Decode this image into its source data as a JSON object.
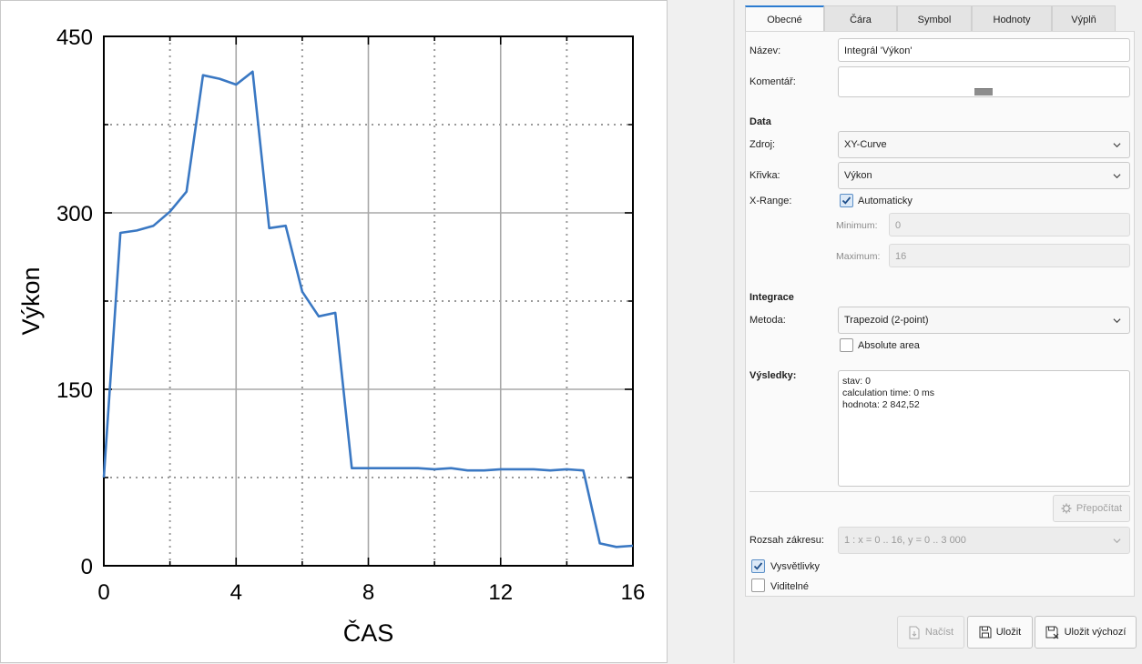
{
  "chart_data": {
    "type": "line",
    "xlabel": "ČAS",
    "ylabel": "Výkon",
    "xlim": [
      0,
      16
    ],
    "ylim": [
      0,
      450
    ],
    "x_ticks": [
      0,
      4,
      8,
      12,
      16
    ],
    "y_ticks": [
      0,
      150,
      300,
      450
    ],
    "grid": true,
    "series": [
      {
        "color": "#3a78c3",
        "x": [
          0,
          0.5,
          1,
          1.5,
          2,
          2.5,
          3,
          3.5,
          4,
          4.5,
          5,
          5.5,
          6,
          6.5,
          7,
          7.5,
          8,
          8.5,
          9,
          9.5,
          10,
          10.5,
          11,
          11.5,
          12,
          12.5,
          13,
          13.5,
          14,
          14.5,
          15,
          15.5,
          16
        ],
        "y": [
          75,
          283,
          285,
          289,
          301,
          318,
          417,
          414,
          409,
          420,
          287,
          289,
          233,
          212,
          215,
          83,
          83,
          83,
          83,
          83,
          82,
          83,
          81,
          81,
          82,
          82,
          82,
          81,
          82,
          81,
          19,
          16,
          17
        ]
      }
    ]
  },
  "tabs": [
    "Obecné",
    "Čára",
    "Symbol",
    "Hodnoty",
    "Výplň"
  ],
  "form": {
    "name_label": "Název:",
    "name_value": "Integrál 'Výkon'",
    "comment_label": "Komentář:",
    "data_section": "Data",
    "source_label": "Zdroj:",
    "source_value": "XY-Curve",
    "curve_label": "Křivka:",
    "curve_value": "Výkon",
    "xrange_label": "X-Range:",
    "auto_label": "Automaticky",
    "min_label": "Minimum:",
    "min_value": "0",
    "max_label": "Maximum:",
    "max_value": "16",
    "integration_section": "Integrace",
    "method_label": "Metoda:",
    "method_value": "Trapezoid (2-point)",
    "absolute_label": "Absolute area",
    "results_label": "Výsledky:",
    "result_lines": [
      "stav: 0",
      "calculation time: 0 ms",
      "hodnota: 2 842,52"
    ],
    "recalc_label": "Přepočítat",
    "plot_range_label": "Rozsah zákresu:",
    "plot_range_value": "1 : x = 0 .. 16, y = 0 .. 3 000",
    "legend_label": "Vysvětlivky",
    "visible_label": "Viditelné"
  },
  "buttons": {
    "load": "Načíst",
    "save": "Uložit",
    "save_default": "Uložit výchozí"
  }
}
